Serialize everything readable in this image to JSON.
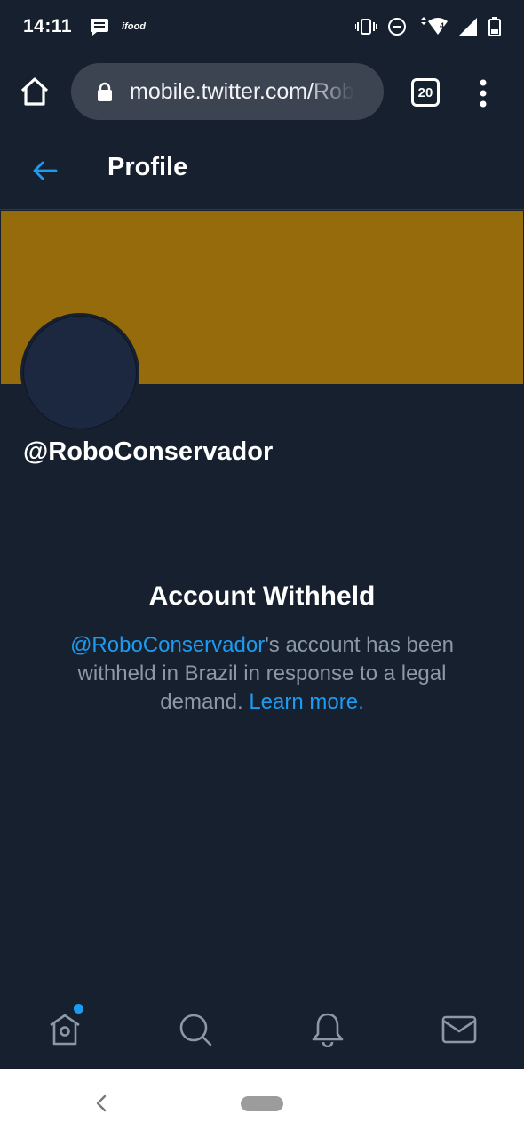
{
  "status_bar": {
    "time": "14:11",
    "notification_icons": [
      "message-icon",
      "ifood-icon"
    ],
    "ifood_label": "ifood",
    "right_icons": [
      "vibrate-icon",
      "dnd-icon",
      "wifi-icon",
      "signal-icon",
      "battery-icon"
    ],
    "wifi_badge": "4"
  },
  "browser": {
    "url_primary": "mobile.twitter.com/",
    "url_rest": "Rob",
    "tab_count": "20",
    "icons": [
      "home-icon",
      "lock-icon",
      "more-vert-icon"
    ]
  },
  "header": {
    "title": "Profile",
    "back_icon": "arrow-left-icon"
  },
  "profile": {
    "handle": "@RoboConservador",
    "banner_color": "#966b0b"
  },
  "notice": {
    "title": "Account Withheld",
    "handle_link": "@RoboConservador",
    "body_text": "'s account has been withheld in Brazil in response to a legal demand. ",
    "learn_more": "Learn more",
    "period": "."
  },
  "bottom_nav": {
    "items": [
      "home-icon",
      "search-icon",
      "notifications-icon",
      "messages-icon"
    ],
    "home_has_notification": true
  },
  "colors": {
    "background": "#17202e",
    "accent": "#1d9bf0",
    "muted_text": "#8b98a5"
  }
}
